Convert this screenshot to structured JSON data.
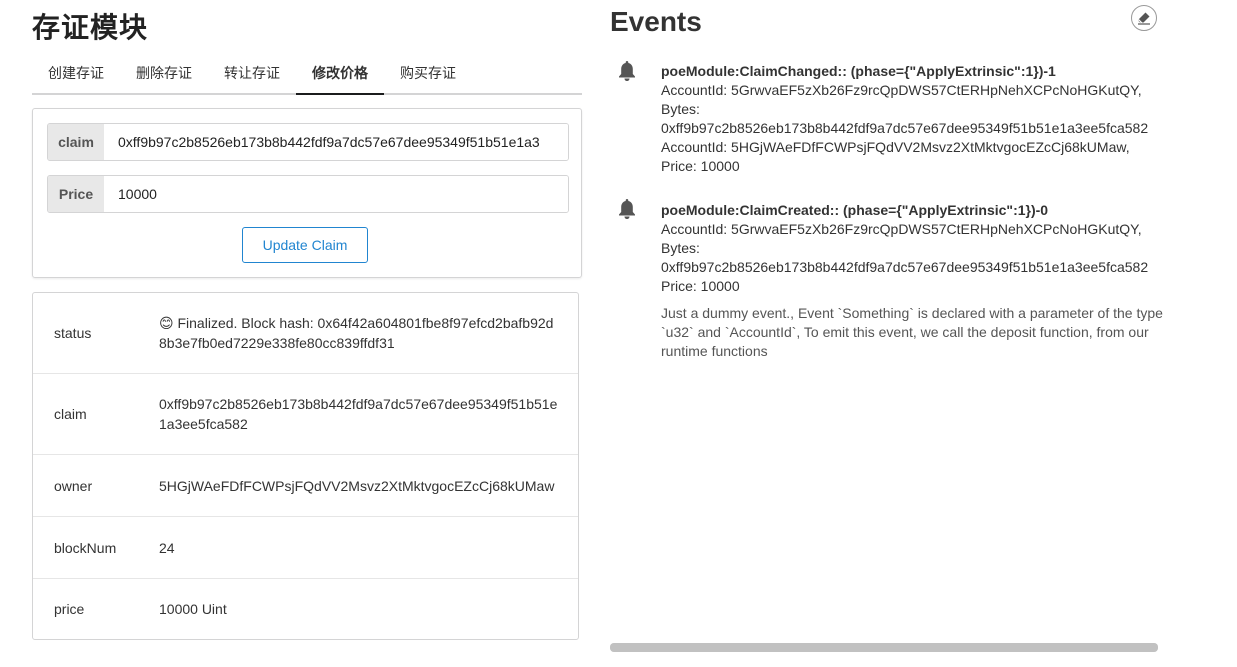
{
  "module": {
    "title": "存证模块",
    "tabs": [
      "创建存证",
      "删除存证",
      "转让存证",
      "修改价格",
      "购买存证"
    ],
    "active_tab": "修改价格"
  },
  "form": {
    "claim_label": "claim",
    "claim_value": "0xff9b97c2b8526eb173b8b442fdf9a7dc57e67dee95349f51b51e1a3",
    "price_label": "Price",
    "price_value": "10000",
    "submit_label": "Update Claim"
  },
  "status": {
    "rows": [
      {
        "key": "status",
        "value": "😊 Finalized. Block hash: 0x64f42a604801fbe8f97efcd2bafb92d8b3e7fb0ed7229e338fe80cc839ffdf31"
      },
      {
        "key": "claim",
        "value": "0xff9b97c2b8526eb173b8b442fdf9a7dc57e67dee95349f51b51e1a3ee5fca582"
      },
      {
        "key": "owner",
        "value": "5HGjWAeFDfFCWPsjFQdVV2Msvz2XtMktvgocEZcCj68kUMaw"
      },
      {
        "key": "blockNum",
        "value": "24"
      },
      {
        "key": "price",
        "value": "10000 Uint"
      }
    ]
  },
  "events": {
    "title": "Events",
    "clear_icon": "eraser-icon",
    "items": [
      {
        "title": "poeModule:ClaimChanged:: (phase={\"ApplyExtrinsic\":1})-1",
        "lines": [
          "AccountId: 5GrwvaEF5zXb26Fz9rcQpDWS57CtERHpNehXCPcNoHGKutQY,",
          "Bytes:",
          "0xff9b97c2b8526eb173b8b442fdf9a7dc57e67dee95349f51b51e1a3ee5fca582",
          "AccountId: 5HGjWAeFDfFCWPsjFQdVV2Msvz2XtMktvgocEZcCj68kUMaw,",
          "Price: 10000"
        ],
        "desc": ""
      },
      {
        "title": "poeModule:ClaimCreated:: (phase={\"ApplyExtrinsic\":1})-0",
        "lines": [
          "AccountId: 5GrwvaEF5zXb26Fz9rcQpDWS57CtERHpNehXCPcNoHGKutQY,",
          "Bytes:",
          "0xff9b97c2b8526eb173b8b442fdf9a7dc57e67dee95349f51b51e1a3ee5fca582",
          "Price: 10000"
        ],
        "desc": "Just a dummy event., Event `Something` is declared with a parameter of the type `u32` and `AccountId`, To emit this event, we call the deposit function, from our runtime functions"
      }
    ]
  }
}
